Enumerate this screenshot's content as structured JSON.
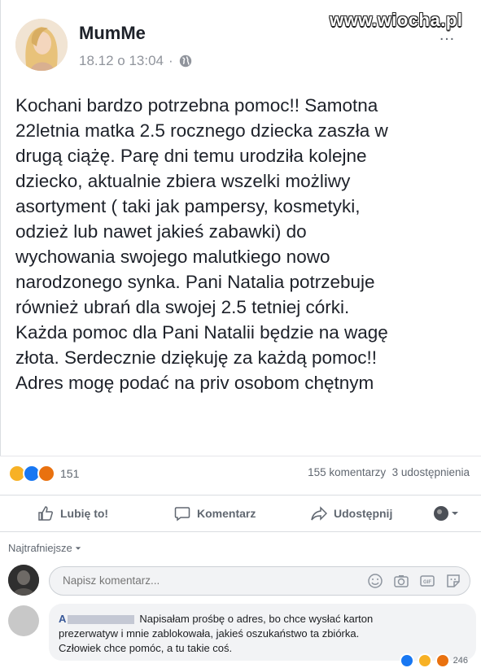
{
  "watermark": "www.wiocha.pl",
  "post": {
    "author": "MumMe",
    "timestamp": "18.12 o 13:04",
    "separator": "·",
    "options_icon": "…",
    "body_lines": [
      "Kochani bardzo potrzebna pomoc!! Samotna",
      "22letnia matka 2.5 rocznego dziecka zaszła w",
      "drugą ciążę. Parę dni temu urodziła kolejne",
      "dziecko, aktualnie zbiera wszelki możliwy",
      "asortyment ( taki jak pampersy, kosmetyki,",
      "odzież lub nawet jakieś zabawki) do",
      "wychowania swojego malutkiego  nowo",
      "narodzonego synka. Pani Natalia potrzebuje",
      "również ubrań dla swojej 2.5 tetniej córki.",
      "Każda pomoc dla Pani Natalii będzie na wagę",
      "złota. Serdecznie dziękuję za każdą pomoc!!",
      "Adres mogę podać na priv osobom chętnym"
    ]
  },
  "reactions": {
    "count": "151",
    "comments": "155 komentarzy",
    "shares": "3 udostępnienia",
    "colors": {
      "haha": "#f7b125",
      "like": "#1877f2",
      "angry": "#e9710f"
    }
  },
  "actions": {
    "like": "Lubię to!",
    "comment": "Komentarz",
    "share": "Udostępnij"
  },
  "comments": {
    "sort_label": "Najtrafniejsze",
    "input_placeholder": "Napisz komentarz...",
    "reply": {
      "author_initial": "A",
      "line1": "Napisałam prośbę o adres, bo chce wysłać karton",
      "line2": "prezerwatyw i mnie zablokowała, jakieś oszukaństwo ta zbiórka.",
      "line3": "Człowiek chce pomóc, a tu takie coś.",
      "reaction_count": "246"
    }
  }
}
